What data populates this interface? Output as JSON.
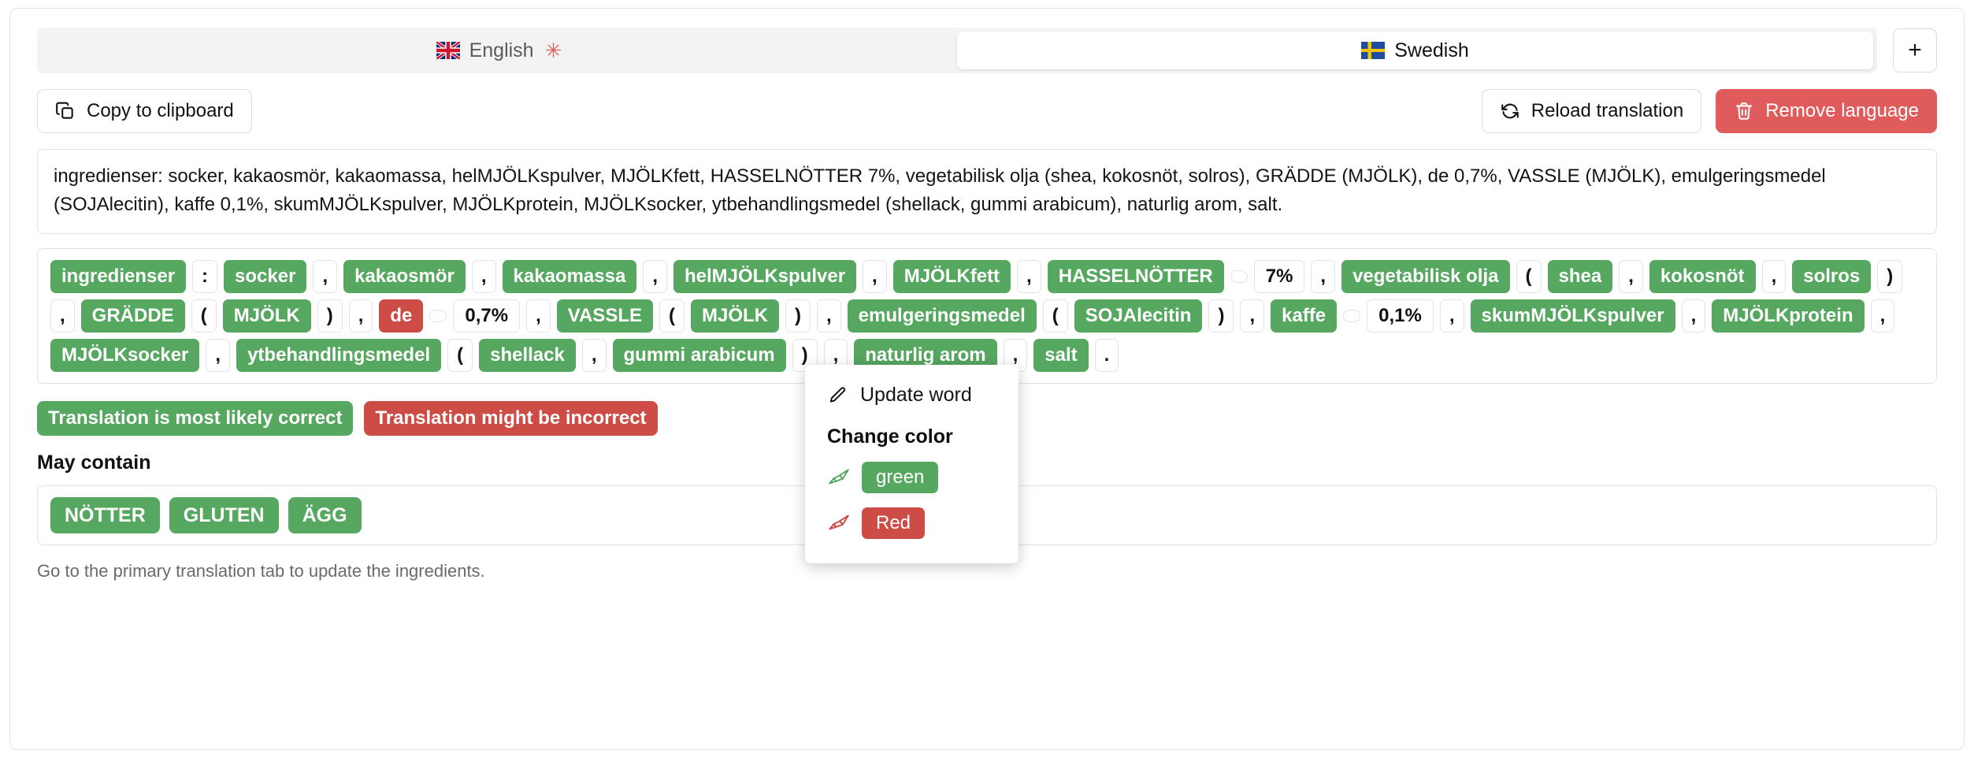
{
  "tabs": [
    {
      "label": "English",
      "flag": "uk-flag-icon",
      "active": false,
      "primary_marker": "✳"
    },
    {
      "label": "Swedish",
      "flag": "swedish-flag-icon",
      "active": true,
      "primary_marker": ""
    }
  ],
  "add_language_button": {
    "label": "+",
    "icon": "plus-icon"
  },
  "toolbar": {
    "copy_label": "Copy to clipboard",
    "copy_icon": "copy-icon",
    "reload_label": "Reload translation",
    "reload_icon": "refresh-icon",
    "remove_label": "Remove language",
    "remove_icon": "trash-icon"
  },
  "ingredients_text": "ingredienser: socker, kakaosmör, kakaomassa, helMJÖLKspulver, MJÖLKfett, HASSELNÖTTER 7%, vegetabilisk olja (shea, kokosnöt, solros), GRÄDDE (MJÖLK), de 0,7%, VASSLE (MJÖLK), emulgeringsmedel (SOJAlecitin), kaffe 0,1%, skumMJÖLKspulver, MJÖLKprotein, MJÖLKsocker, ytbehandlingsmedel (shellack, gummi arabicum), naturlig arom, salt.",
  "chips": [
    {
      "text": "ingredienser",
      "type": "word"
    },
    {
      "text": ":",
      "type": "punct"
    },
    {
      "text": "socker",
      "type": "word"
    },
    {
      "text": ",",
      "type": "punct"
    },
    {
      "text": "kakaosmör",
      "type": "word"
    },
    {
      "text": ",",
      "type": "punct"
    },
    {
      "text": "kakaomassa",
      "type": "word"
    },
    {
      "text": ",",
      "type": "punct"
    },
    {
      "text": "helMJÖLKspulver",
      "type": "word"
    },
    {
      "text": ",",
      "type": "punct"
    },
    {
      "text": "MJÖLKfett",
      "type": "word"
    },
    {
      "text": ",",
      "type": "punct"
    },
    {
      "text": "HASSELNÖTTER",
      "type": "word"
    },
    {
      "text": "",
      "type": "space"
    },
    {
      "text": "7%",
      "type": "num"
    },
    {
      "text": ",",
      "type": "punct"
    },
    {
      "text": "vegetabilisk olja",
      "type": "word"
    },
    {
      "text": "(",
      "type": "punct"
    },
    {
      "text": "shea",
      "type": "word"
    },
    {
      "text": ",",
      "type": "punct"
    },
    {
      "text": "kokosnöt",
      "type": "word"
    },
    {
      "text": ",",
      "type": "punct"
    },
    {
      "text": "solros",
      "type": "word"
    },
    {
      "text": ")",
      "type": "punct"
    },
    {
      "text": ",",
      "type": "punct"
    },
    {
      "text": "GRÄDDE",
      "type": "word"
    },
    {
      "text": "(",
      "type": "punct"
    },
    {
      "text": "MJÖLK",
      "type": "word"
    },
    {
      "text": ")",
      "type": "punct"
    },
    {
      "text": ",",
      "type": "punct"
    },
    {
      "text": "de",
      "type": "word-red"
    },
    {
      "text": "",
      "type": "space"
    },
    {
      "text": "0,7%",
      "type": "num"
    },
    {
      "text": ",",
      "type": "punct"
    },
    {
      "text": "VASSLE",
      "type": "word"
    },
    {
      "text": "(",
      "type": "punct"
    },
    {
      "text": "MJÖLK",
      "type": "word"
    },
    {
      "text": ")",
      "type": "punct"
    },
    {
      "text": ",",
      "type": "punct"
    },
    {
      "text": "emulgeringsmedel",
      "type": "word"
    },
    {
      "text": "(",
      "type": "punct"
    },
    {
      "text": "SOJAlecitin",
      "type": "word"
    },
    {
      "text": ")",
      "type": "punct"
    },
    {
      "text": ",",
      "type": "punct"
    },
    {
      "text": "kaffe",
      "type": "word"
    },
    {
      "text": "",
      "type": "space"
    },
    {
      "text": "0,1%",
      "type": "num"
    },
    {
      "text": ",",
      "type": "punct"
    },
    {
      "text": "skumMJÖLKspulver",
      "type": "word"
    },
    {
      "text": ",",
      "type": "punct"
    },
    {
      "text": "MJÖLKprotein",
      "type": "word"
    },
    {
      "text": ",",
      "type": "punct"
    },
    {
      "text": "MJÖLKsocker",
      "type": "word"
    },
    {
      "text": ",",
      "type": "punct"
    },
    {
      "text": "ytbehandlingsmedel",
      "type": "word"
    },
    {
      "text": "(",
      "type": "punct"
    },
    {
      "text": "shellack",
      "type": "word"
    },
    {
      "text": ",",
      "type": "punct"
    },
    {
      "text": "gummi arabicum",
      "type": "word"
    },
    {
      "text": ")",
      "type": "punct"
    },
    {
      "text": ",",
      "type": "punct"
    },
    {
      "text": "naturlig arom",
      "type": "word"
    },
    {
      "text": ",",
      "type": "punct"
    },
    {
      "text": "salt",
      "type": "word"
    },
    {
      "text": ".",
      "type": "punct"
    }
  ],
  "popup": {
    "update_word_label": "Update word",
    "update_word_icon": "pencil-icon",
    "change_color_heading": "Change color",
    "colors": [
      {
        "label": "green",
        "icon": "paintbrush-icon",
        "hex": "#56a75f"
      },
      {
        "label": "Red",
        "icon": "paintbrush-icon",
        "hex": "#ce4c46"
      }
    ]
  },
  "status": {
    "correct_label": "Translation is most likely correct",
    "correct_hex": "#56a75f",
    "incorrect_label": "Translation might be incorrect",
    "incorrect_hex": "#ce4c46"
  },
  "may_contain": {
    "title": "May contain",
    "items": [
      "NÖTTER",
      "GLUTEN",
      "ÄGG"
    ]
  },
  "footnote": "Go to the primary translation tab to update the ingredients."
}
